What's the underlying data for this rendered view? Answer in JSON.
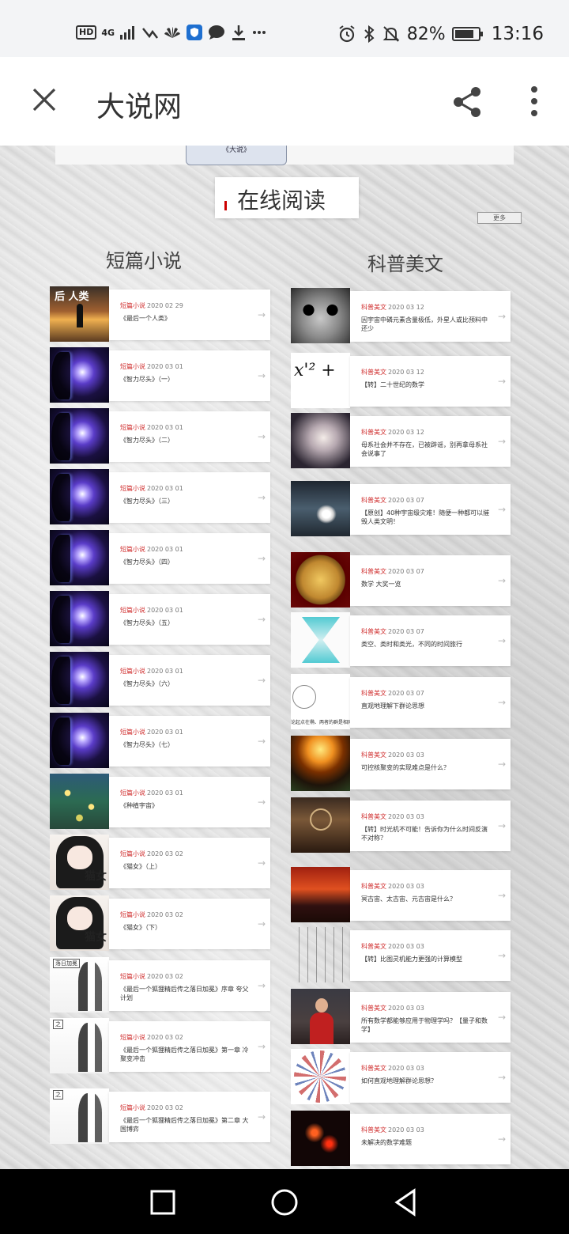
{
  "status_bar": {
    "left_hd": "HD",
    "left_net": "4G",
    "battery_pct": "82%",
    "battery_level": 0.82,
    "time": "13:16"
  },
  "app_bar": {
    "title": "大说网",
    "close_icon": "close-icon",
    "share_icon": "share-icon",
    "more_icon": "more-vert-icon"
  },
  "page": {
    "top_tab": "《大说》",
    "heading": "在线阅读",
    "more_link": "更多",
    "left_column_title": "短篇小说",
    "right_column_title": "科普美文",
    "arrow": "→"
  },
  "left_items": [
    {
      "category": "短篇小说",
      "date": "2020 02 29",
      "title": "《最后一个人类》",
      "thumb": "after",
      "thumb_text": "后 人类"
    },
    {
      "category": "短篇小说",
      "date": "2020 03 01",
      "title": "《智力尽头》（一）",
      "thumb": "wisdom"
    },
    {
      "category": "短篇小说",
      "date": "2020 03 01",
      "title": "《智力尽头》（二）",
      "thumb": "wisdom"
    },
    {
      "category": "短篇小说",
      "date": "2020 03 01",
      "title": "《智力尽头》（三）",
      "thumb": "wisdom"
    },
    {
      "category": "短篇小说",
      "date": "2020 03 01",
      "title": "《智力尽头》（四）",
      "thumb": "wisdom"
    },
    {
      "category": "短篇小说",
      "date": "2020 03 01",
      "title": "《智力尽头》（五）",
      "thumb": "wisdom"
    },
    {
      "category": "短篇小说",
      "date": "2020 03 01",
      "title": "《智力尽头》（六）",
      "thumb": "wisdom"
    },
    {
      "category": "短篇小说",
      "date": "2020 03 01",
      "title": "《智力尽头》（七）",
      "thumb": "wisdom"
    },
    {
      "category": "短篇小说",
      "date": "2020 03 01",
      "title": "《种植宇宙》",
      "thumb": "plant"
    },
    {
      "category": "短篇小说",
      "date": "2020 03 02",
      "title": "《猫女》（上）",
      "thumb": "cat",
      "thumb_text": "猫女"
    },
    {
      "category": "短篇小说",
      "date": "2020 03 02",
      "title": "《猫女》（下）",
      "thumb": "cat",
      "thumb_text": "猫女"
    },
    {
      "category": "短篇小说",
      "date": "2020 03 02",
      "title": "《最后一个狐狸精后传之落日加冕》序章 夸父计划",
      "thumb": "fox",
      "thumb_text": "落日加冕"
    },
    {
      "category": "短篇小说",
      "date": "2020 03 02",
      "title": "《最后一个狐狸精后传之落日加冕》第一章 冷聚变冲击",
      "thumb": "fox",
      "thumb_text": "之"
    },
    {
      "category": "短篇小说",
      "date": "2020 03 02",
      "title": "《最后一个狐狸精后传之落日加冕》第二章 大国博弈",
      "thumb": "fox",
      "thumb_text": "之"
    }
  ],
  "right_items": [
    {
      "category": "科普美文",
      "date": "2020 03 12",
      "title": "因宇宙中磷元素含量极低，外星人或比预料中还少",
      "thumb": "alien"
    },
    {
      "category": "科普美文",
      "date": "2020 03 12",
      "title": "【转】二十世纪的数学",
      "thumb": "math",
      "thumb_text": "x'² +"
    },
    {
      "category": "科普美文",
      "date": "2020 03 12",
      "title": "母系社会并不存在，已被辟谣，别再拿母系社会说事了",
      "thumb": "angel"
    },
    {
      "category": "科普美文",
      "date": "2020 03 07",
      "title": "【原创】40种宇宙级灾难！随便一种都可以摧毁人类文明！",
      "thumb": "comet"
    },
    {
      "category": "科普美文",
      "date": "2020 03 07",
      "title": "数学 大奖一览",
      "thumb": "medal"
    },
    {
      "category": "科普美文",
      "date": "2020 03 07",
      "title": "类空、类时和类光，不同的时间旅行",
      "thumb": "cone"
    },
    {
      "category": "科普美文",
      "date": "2020 03 07",
      "title": "直观地理解下群论思想",
      "thumb": "group",
      "thumb_text": "论起点在椭、两者的群是相同"
    },
    {
      "category": "科普美文",
      "date": "2020 03 03",
      "title": "可控核聚变的实现难点是什么？",
      "thumb": "sun"
    },
    {
      "category": "科普美文",
      "date": "2020 03 03",
      "title": "【转】时光机不可能！告诉你为什么时间反演不对称？",
      "thumb": "time"
    },
    {
      "category": "科普美文",
      "date": "2020 03 03",
      "title": "冥古宙、太古宙、元古宙是什么？",
      "thumb": "volcano"
    },
    {
      "category": "科普美文",
      "date": "2020 03 03",
      "title": "【转】比图灵机能力更强的计算模型",
      "thumb": "graph"
    },
    {
      "category": "科普美文",
      "date": "2020 03 03",
      "title": "所有数学都能够应用于物理学吗？【量子和数学】",
      "thumb": "person"
    },
    {
      "category": "科普美文",
      "date": "2020 03 03",
      "title": "如何直观地理解群论思想？",
      "thumb": "bucky"
    },
    {
      "category": "科普美文",
      "date": "2020 03 03",
      "title": "未解决的数学难题",
      "thumb": "unsolved"
    }
  ]
}
